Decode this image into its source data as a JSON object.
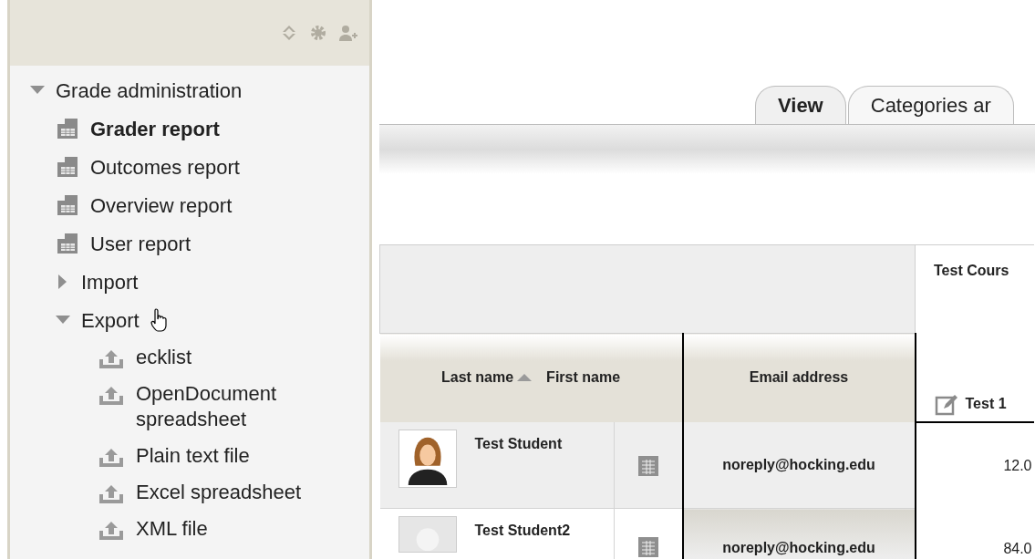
{
  "sidebar": {
    "tree": {
      "label": "Grade administration",
      "expanded": true,
      "children": [
        {
          "kind": "report",
          "label": "Grader report",
          "selected": true
        },
        {
          "kind": "report",
          "label": "Outcomes report",
          "selected": false
        },
        {
          "kind": "report",
          "label": "Overview report",
          "selected": false
        },
        {
          "kind": "report",
          "label": "User report",
          "selected": false
        },
        {
          "kind": "folder",
          "label": "Import",
          "expanded": false
        },
        {
          "kind": "folder",
          "label": "Export",
          "expanded": true,
          "children": [
            {
              "kind": "export",
              "label": "ecklist"
            },
            {
              "kind": "export",
              "label": "OpenDocument spreadsheet"
            },
            {
              "kind": "export",
              "label": "Plain text file"
            },
            {
              "kind": "export",
              "label": "Excel spreadsheet"
            },
            {
              "kind": "export",
              "label": "XML file"
            }
          ]
        }
      ]
    }
  },
  "tabs": [
    {
      "label": "View",
      "selected": true
    },
    {
      "label": "Categories ar",
      "selected": false
    }
  ],
  "table": {
    "course": "Test Cours",
    "columns": {
      "last_name": "Last name",
      "first_name": "First name",
      "email": "Email address",
      "item": "Test 1"
    },
    "rows": [
      {
        "name": "Test Student",
        "photo": true,
        "email": "noreply@hocking.edu",
        "grade": "12.0"
      },
      {
        "name": "Test Student2",
        "photo": false,
        "email": "noreply@hocking.edu",
        "grade": "84.0"
      }
    ]
  }
}
